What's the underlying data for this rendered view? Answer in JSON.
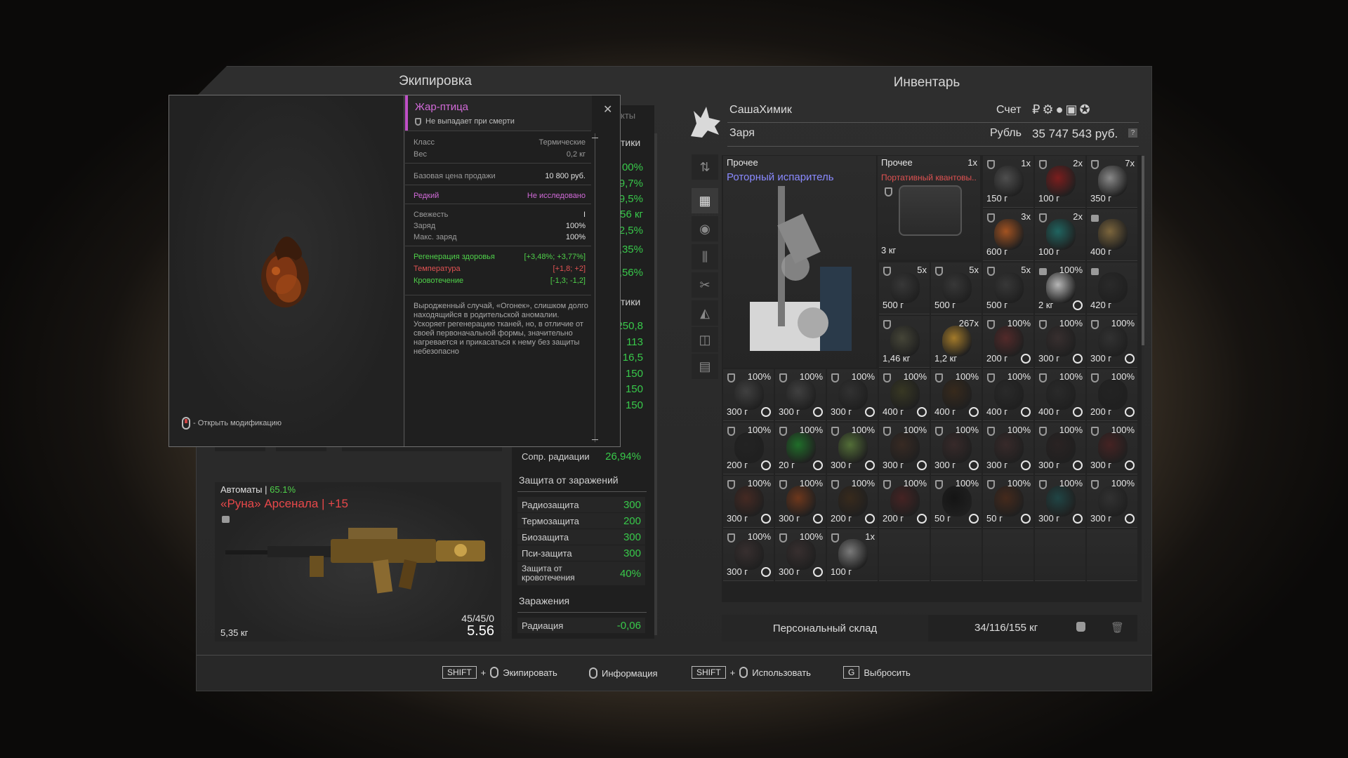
{
  "panels": {
    "equipment_title": "Экипировка",
    "inventory_title": "Инвентарь"
  },
  "player": {
    "name": "СашаХимик",
    "faction": "Заря",
    "account_label": "Счет",
    "currency_label": "Рубль",
    "balance": "35 747 543 руб.",
    "help": "?"
  },
  "tooltip": {
    "title": "Жар-птица",
    "no_drop": "Не выпадает при смерти",
    "class_label": "Класс",
    "class_value": "Термические",
    "weight_label": "Вес",
    "weight_value": "0,2 кг",
    "price_label": "Базовая цена продажи",
    "price_value": "10 800 руб.",
    "rarity": "Редкий",
    "research": "Не исследовано",
    "freshness_label": "Свежесть",
    "freshness_value": "I",
    "charge_label": "Заряд",
    "charge_value": "100%",
    "maxcharge_label": "Макс. заряд",
    "maxcharge_value": "100%",
    "effects": [
      {
        "label": "Регенерация здоровья",
        "value": "[+3,48%; +3,77%]",
        "color": "#4fd14a"
      },
      {
        "label": "Температура",
        "value": "[+1,8; +2]",
        "color": "#e05252"
      },
      {
        "label": "Кровотечение",
        "value": "[-1,3; -1,2]",
        "color": "#4fd14a"
      }
    ],
    "description": "Выродженный случай, «Огонек», слишком долго находящийся в родительской аномалии. Ускоряет регенерацию тканей, но, в отличие от своей первоначальной формы, значительно нагревается и прикасаться к нему без защиты небезопасно",
    "open_mod_hint": "- Открыть модификацию"
  },
  "stats_partial": {
    "tab_partial": "кты",
    "sect1_partial": "тики",
    "sect2_partial": "тики",
    "vals1": [
      "00%",
      "9,7%",
      "9,5%",
      "56 кг",
      "2,5%",
      ",35%",
      ",56%"
    ],
    "vals2": [
      "250,8",
      "113",
      "16,5",
      "150",
      "150",
      "150"
    ]
  },
  "stats": {
    "radiation_res_label": "Сопр. радиации",
    "radiation_res_value": "26,94%",
    "protection_title": "Защита от заражений",
    "protection": [
      {
        "label": "Радиозащита",
        "value": "300"
      },
      {
        "label": "Термозащита",
        "value": "200"
      },
      {
        "label": "Биозащита",
        "value": "300"
      },
      {
        "label": "Пси-защита",
        "value": "300"
      },
      {
        "label": "Защита от кровотечения",
        "value": "40%"
      }
    ],
    "contam_title": "Заражения",
    "contam": [
      {
        "label": "Радиация",
        "value": "-0,06"
      }
    ]
  },
  "weapon": {
    "category": "Автоматы",
    "condition": "65.1%",
    "name": "«Руна» Арсенала | +15",
    "ammo": "45/45/0",
    "caliber": "5.56",
    "weight": "5,35 кг"
  },
  "inventory": {
    "featured": {
      "category": "Прочее",
      "name": "Роторный испаритель"
    },
    "big2": {
      "category": "Прочее",
      "count": "1x",
      "name": "Портативный квантовы..",
      "weight": "3 кг"
    },
    "cells": [
      {
        "count": "1x",
        "weight": "150 г",
        "icon": "shield",
        "color": "#555"
      },
      {
        "count": "2x",
        "weight": "100 г",
        "icon": "shield",
        "color": "#8a1c1c"
      },
      {
        "count": "7x",
        "weight": "350 г",
        "icon": "shield",
        "color": "#9a9a9a"
      },
      {
        "count": "3x",
        "weight": "600 г",
        "icon": "shield",
        "color": "#b85a20"
      },
      {
        "count": "2x",
        "weight": "100 г",
        "icon": "shield",
        "color": "#1f6f6a"
      },
      {
        "count": "",
        "weight": "400 г",
        "icon": "lock",
        "color": "#8a7040"
      },
      {
        "count": "5x",
        "weight": "500 г",
        "icon": "shield",
        "color": "#3a3a3a"
      },
      {
        "count": "5x",
        "weight": "500 г",
        "icon": "shield",
        "color": "#3a3a3a"
      },
      {
        "count": "5x",
        "weight": "500 г",
        "icon": "shield",
        "color": "#3a3a3a"
      },
      {
        "count": "100%",
        "weight": "2 кг",
        "icon": "lock",
        "color": "#cfcfcf"
      },
      {
        "count": "",
        "weight": "420 г",
        "icon": "lock",
        "color": "#2a2a2a"
      },
      {
        "count": "",
        "weight": "1,46 кг",
        "icon": "shield",
        "color": "#4a4a3a"
      },
      {
        "count": "267x",
        "weight": "1,2 кг",
        "icon": "none",
        "color": "#b8882a"
      },
      {
        "count": "100%",
        "weight": "200 г",
        "icon": "shield",
        "color": "#5a2a2a"
      },
      {
        "count": "100%",
        "weight": "300 г",
        "icon": "shield",
        "color": "#3a3030"
      },
      {
        "count": "100%",
        "weight": "300 г",
        "icon": "shield",
        "color": "#333"
      },
      {
        "count": "100%",
        "weight": "300 г",
        "icon": "shield",
        "color": "#444"
      },
      {
        "count": "100%",
        "weight": "300 г",
        "icon": "shield",
        "color": "#444"
      },
      {
        "count": "100%",
        "weight": "300 г",
        "icon": "shield",
        "color": "#333"
      },
      {
        "count": "100%",
        "weight": "400 г",
        "icon": "shield",
        "color": "#3a3a22"
      },
      {
        "count": "100%",
        "weight": "400 г",
        "icon": "shield",
        "color": "#3a2a1a"
      },
      {
        "count": "100%",
        "weight": "400 г",
        "icon": "shield",
        "color": "#2a2a2a"
      },
      {
        "count": "100%",
        "weight": "400 г",
        "icon": "shield",
        "color": "#2a2a2a"
      },
      {
        "count": "100%",
        "weight": "200 г",
        "icon": "shield",
        "color": "#222"
      },
      {
        "count": "100%",
        "weight": "200 г",
        "icon": "shield",
        "color": "#222"
      },
      {
        "count": "100%",
        "weight": "20 г",
        "icon": "shield",
        "color": "#1f7a2a"
      },
      {
        "count": "100%",
        "weight": "300 г",
        "icon": "shield",
        "color": "#5a7a3a"
      },
      {
        "count": "100%",
        "weight": "300 г",
        "icon": "shield",
        "color": "#3a2a22"
      },
      {
        "count": "100%",
        "weight": "300 г",
        "icon": "shield",
        "color": "#3a2a2a"
      },
      {
        "count": "100%",
        "weight": "300 г",
        "icon": "shield",
        "color": "#3a2a2a"
      },
      {
        "count": "100%",
        "weight": "300 г",
        "icon": "shield",
        "color": "#2a2222"
      },
      {
        "count": "100%",
        "weight": "300 г",
        "icon": "shield",
        "color": "#4a2222"
      },
      {
        "count": "100%",
        "weight": "300 г",
        "icon": "shield",
        "color": "#4a2a22"
      },
      {
        "count": "100%",
        "weight": "300 г",
        "icon": "shield",
        "color": "#7a3a1a"
      },
      {
        "count": "100%",
        "weight": "200 г",
        "icon": "shield",
        "color": "#3a2a1a"
      },
      {
        "count": "100%",
        "weight": "200 г",
        "icon": "shield",
        "color": "#4a2222"
      },
      {
        "count": "100%",
        "weight": "50 г",
        "icon": "shield",
        "color": "#111"
      },
      {
        "count": "100%",
        "weight": "50 г",
        "icon": "shield",
        "color": "#4a2a1a"
      },
      {
        "count": "100%",
        "weight": "300 г",
        "icon": "shield",
        "color": "#1f4a4a"
      },
      {
        "count": "100%",
        "weight": "300 г",
        "icon": "shield",
        "color": "#333"
      },
      {
        "count": "100%",
        "weight": "300 г",
        "icon": "shield",
        "color": "#3a3030"
      },
      {
        "count": "100%",
        "weight": "300 г",
        "icon": "shield",
        "color": "#3a3030"
      },
      {
        "count": "1x",
        "weight": "100 г",
        "icon": "shield",
        "color": "#888"
      }
    ],
    "storage_label": "Персональный склад",
    "weight_total": "34/116/155 кг"
  },
  "hints": {
    "shift": "SHIFT",
    "plus": "+",
    "equip": "Экипировать",
    "info": "Информация",
    "use": "Использовать",
    "g_key": "G",
    "drop": "Выбросить"
  }
}
